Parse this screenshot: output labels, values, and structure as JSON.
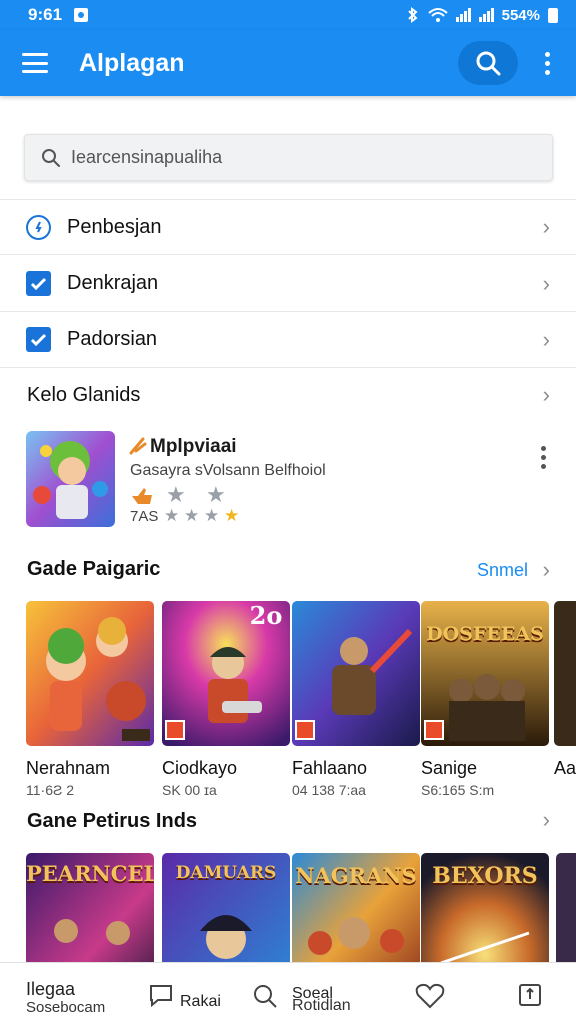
{
  "status": {
    "time": "9:61",
    "battery": "554%"
  },
  "app_bar": {
    "title": "Alplagan"
  },
  "search": {
    "placeholder": "Iearcensinapualiha"
  },
  "menu": [
    {
      "label": "Penbesjan",
      "icon": "clock-icon"
    },
    {
      "label": "Denkrajan",
      "icon": "checkbox-icon"
    },
    {
      "label": "Padorsian",
      "icon": "checkbox-icon"
    }
  ],
  "featured_section": {
    "title": "Kelo Glanids",
    "app": {
      "title": "Mplpviaai",
      "subtitle": "Gasayra sVolsann Belfhoiol",
      "count": "7AS",
      "rating": 0.2
    }
  },
  "section2": {
    "title": "Gade Paigaric",
    "see_all": "Snmel",
    "items": [
      {
        "name": "Nerahnam",
        "meta": "11·6Ƨ 2"
      },
      {
        "name": "Ciodkayo",
        "meta": "SK 00 ɪa"
      },
      {
        "name": "Fahlaano",
        "meta": "04 138 7:aa"
      },
      {
        "name": "Sanige",
        "meta": "S6:165 S:m"
      },
      {
        "name": "Aa",
        "meta": ""
      }
    ]
  },
  "section3": {
    "title": "Gane Petirus Inds",
    "items": [
      {
        "art_text": "PEARNCEL"
      },
      {
        "art_text": "DAMUARS"
      },
      {
        "art_text": "NAGRANS"
      },
      {
        "art_text": "BEXORS"
      }
    ]
  },
  "card_art_titles": [
    "",
    "2o",
    "",
    "DOSFEEAS",
    ""
  ],
  "bottom_nav": [
    {
      "label": "Ilegaa",
      "sub": "Sosebocam"
    },
    {
      "label": "Rakai",
      "icon": "chat-icon"
    },
    {
      "label": "Soeal",
      "sub": "Rotidlan",
      "icon": "search-icon"
    },
    {
      "label": "",
      "icon": "heart-icon"
    },
    {
      "label": "",
      "icon": "share-icon"
    }
  ],
  "colors": {
    "primary": "#1a8cf2",
    "check": "#1a73d9",
    "star_gold": "#f2b51d",
    "flame": "#e8892a"
  }
}
